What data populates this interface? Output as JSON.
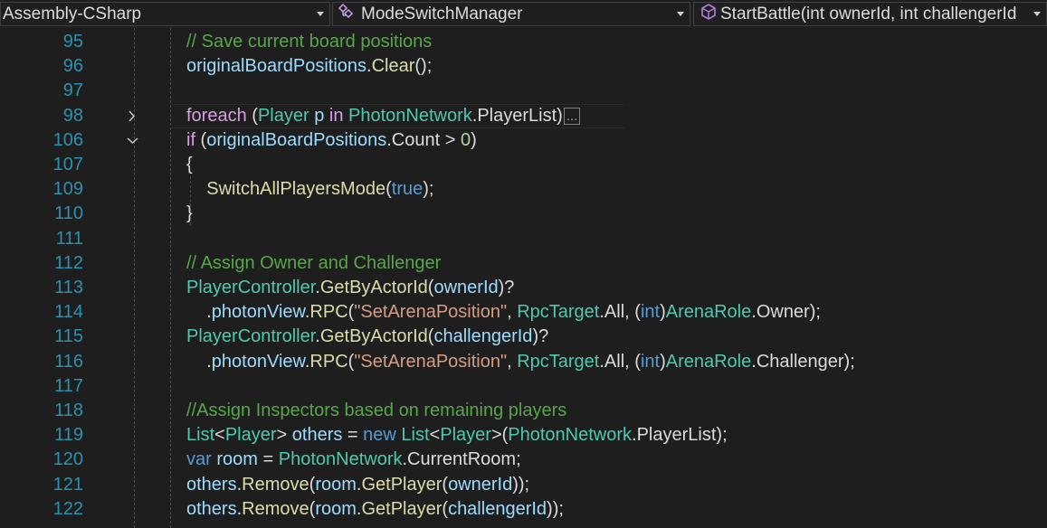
{
  "navbar": {
    "project": "Assembly-CSharp",
    "type": "ModeSwitchManager",
    "member": "StartBattle(int ownerId, int challengerId"
  },
  "colors": {
    "background": "#1e1e1e",
    "line_number": "#2b91af",
    "comment": "#57a64a",
    "control_keyword": "#d8a0df",
    "keyword": "#569cd6",
    "type": "#4ec9b0",
    "variable": "#9cdcfe",
    "method": "#dcdcaa",
    "string": "#d69d85",
    "number": "#b5cea8"
  },
  "lines": [
    {
      "num": "95",
      "fold": "",
      "tokens": [
        {
          "t": "// Save current board positions",
          "c": "c"
        }
      ]
    },
    {
      "num": "96",
      "fold": "",
      "tokens": [
        {
          "t": "originalBoardPositions",
          "c": "v"
        },
        {
          "t": ".",
          "c": "p"
        },
        {
          "t": "Clear",
          "c": "m"
        },
        {
          "t": "();",
          "c": "p"
        }
      ]
    },
    {
      "num": "97",
      "fold": "",
      "tokens": []
    },
    {
      "num": "98",
      "fold": "collapsed",
      "tokens": [
        {
          "t": "foreach",
          "c": "k"
        },
        {
          "t": " (",
          "c": "p"
        },
        {
          "t": "Player",
          "c": "t"
        },
        {
          "t": " ",
          "c": "p"
        },
        {
          "t": "p",
          "c": "v"
        },
        {
          "t": " ",
          "c": "p"
        },
        {
          "t": "in",
          "c": "k"
        },
        {
          "t": " ",
          "c": "p"
        },
        {
          "t": "PhotonNetwork",
          "c": "t"
        },
        {
          "t": ".",
          "c": "p"
        },
        {
          "t": "PlayerList",
          "c": "p"
        },
        {
          "t": ")",
          "c": "p"
        }
      ],
      "ellipsis": "..."
    },
    {
      "num": "106",
      "fold": "expanded",
      "tokens": [
        {
          "t": "if",
          "c": "k"
        },
        {
          "t": " (",
          "c": "p"
        },
        {
          "t": "originalBoardPositions",
          "c": "v"
        },
        {
          "t": ".",
          "c": "p"
        },
        {
          "t": "Count",
          "c": "p"
        },
        {
          "t": " > ",
          "c": "p"
        },
        {
          "t": "0",
          "c": "n"
        },
        {
          "t": ")",
          "c": "p"
        }
      ]
    },
    {
      "num": "107",
      "fold": "",
      "tokens": [
        {
          "t": "{",
          "c": "p"
        }
      ]
    },
    {
      "num": "109",
      "fold": "",
      "tokens": [
        {
          "t": "    ",
          "c": "p"
        },
        {
          "t": "SwitchAllPlayersMode",
          "c": "m"
        },
        {
          "t": "(",
          "c": "p"
        },
        {
          "t": "true",
          "c": "b"
        },
        {
          "t": ");",
          "c": "p"
        }
      ]
    },
    {
      "num": "110",
      "fold": "",
      "tokens": [
        {
          "t": "}",
          "c": "p"
        }
      ]
    },
    {
      "num": "111",
      "fold": "",
      "tokens": []
    },
    {
      "num": "112",
      "fold": "",
      "tokens": [
        {
          "t": "// Assign Owner and Challenger",
          "c": "c"
        }
      ]
    },
    {
      "num": "113",
      "fold": "",
      "tokens": [
        {
          "t": "PlayerController",
          "c": "t"
        },
        {
          "t": ".",
          "c": "p"
        },
        {
          "t": "GetByActorId",
          "c": "m"
        },
        {
          "t": "(",
          "c": "p"
        },
        {
          "t": "ownerId",
          "c": "v"
        },
        {
          "t": ")?",
          "c": "p"
        }
      ]
    },
    {
      "num": "114",
      "fold": "",
      "tokens": [
        {
          "t": "    .",
          "c": "p"
        },
        {
          "t": "photonView",
          "c": "v"
        },
        {
          "t": ".",
          "c": "p"
        },
        {
          "t": "RPC",
          "c": "m"
        },
        {
          "t": "(",
          "c": "p"
        },
        {
          "t": "\"SetArenaPosition\"",
          "c": "s"
        },
        {
          "t": ", ",
          "c": "p"
        },
        {
          "t": "RpcTarget",
          "c": "t"
        },
        {
          "t": ".",
          "c": "p"
        },
        {
          "t": "All",
          "c": "p"
        },
        {
          "t": ", (",
          "c": "p"
        },
        {
          "t": "int",
          "c": "b"
        },
        {
          "t": ")",
          "c": "p"
        },
        {
          "t": "ArenaRole",
          "c": "t"
        },
        {
          "t": ".",
          "c": "p"
        },
        {
          "t": "Owner",
          "c": "p"
        },
        {
          "t": ");",
          "c": "p"
        }
      ]
    },
    {
      "num": "115",
      "fold": "",
      "tokens": [
        {
          "t": "PlayerController",
          "c": "t"
        },
        {
          "t": ".",
          "c": "p"
        },
        {
          "t": "GetByActorId",
          "c": "m"
        },
        {
          "t": "(",
          "c": "p"
        },
        {
          "t": "challengerId",
          "c": "v"
        },
        {
          "t": ")?",
          "c": "p"
        }
      ]
    },
    {
      "num": "116",
      "fold": "",
      "tokens": [
        {
          "t": "    .",
          "c": "p"
        },
        {
          "t": "photonView",
          "c": "v"
        },
        {
          "t": ".",
          "c": "p"
        },
        {
          "t": "RPC",
          "c": "m"
        },
        {
          "t": "(",
          "c": "p"
        },
        {
          "t": "\"SetArenaPosition\"",
          "c": "s"
        },
        {
          "t": ", ",
          "c": "p"
        },
        {
          "t": "RpcTarget",
          "c": "t"
        },
        {
          "t": ".",
          "c": "p"
        },
        {
          "t": "All",
          "c": "p"
        },
        {
          "t": ", (",
          "c": "p"
        },
        {
          "t": "int",
          "c": "b"
        },
        {
          "t": ")",
          "c": "p"
        },
        {
          "t": "ArenaRole",
          "c": "t"
        },
        {
          "t": ".",
          "c": "p"
        },
        {
          "t": "Challenger",
          "c": "p"
        },
        {
          "t": ");",
          "c": "p"
        }
      ]
    },
    {
      "num": "117",
      "fold": "",
      "tokens": []
    },
    {
      "num": "118",
      "fold": "",
      "tokens": [
        {
          "t": "//Assign Inspectors based on remaining players",
          "c": "c"
        }
      ]
    },
    {
      "num": "119",
      "fold": "",
      "tokens": [
        {
          "t": "List",
          "c": "t"
        },
        {
          "t": "<",
          "c": "p"
        },
        {
          "t": "Player",
          "c": "t"
        },
        {
          "t": "> ",
          "c": "p"
        },
        {
          "t": "others",
          "c": "v"
        },
        {
          "t": " = ",
          "c": "p"
        },
        {
          "t": "new",
          "c": "b"
        },
        {
          "t": " ",
          "c": "p"
        },
        {
          "t": "List",
          "c": "t"
        },
        {
          "t": "<",
          "c": "p"
        },
        {
          "t": "Player",
          "c": "t"
        },
        {
          "t": ">(",
          "c": "p"
        },
        {
          "t": "PhotonNetwork",
          "c": "t"
        },
        {
          "t": ".",
          "c": "p"
        },
        {
          "t": "PlayerList",
          "c": "p"
        },
        {
          "t": ");",
          "c": "p"
        }
      ]
    },
    {
      "num": "120",
      "fold": "",
      "tokens": [
        {
          "t": "var",
          "c": "b"
        },
        {
          "t": " ",
          "c": "p"
        },
        {
          "t": "room",
          "c": "v"
        },
        {
          "t": " = ",
          "c": "p"
        },
        {
          "t": "PhotonNetwork",
          "c": "t"
        },
        {
          "t": ".",
          "c": "p"
        },
        {
          "t": "CurrentRoom",
          "c": "p"
        },
        {
          "t": ";",
          "c": "p"
        }
      ]
    },
    {
      "num": "121",
      "fold": "",
      "tokens": [
        {
          "t": "others",
          "c": "v"
        },
        {
          "t": ".",
          "c": "p"
        },
        {
          "t": "Remove",
          "c": "m"
        },
        {
          "t": "(",
          "c": "p"
        },
        {
          "t": "room",
          "c": "v"
        },
        {
          "t": ".",
          "c": "p"
        },
        {
          "t": "GetPlayer",
          "c": "m"
        },
        {
          "t": "(",
          "c": "p"
        },
        {
          "t": "ownerId",
          "c": "v"
        },
        {
          "t": "));",
          "c": "p"
        }
      ]
    },
    {
      "num": "122",
      "fold": "",
      "tokens": [
        {
          "t": "others",
          "c": "v"
        },
        {
          "t": ".",
          "c": "p"
        },
        {
          "t": "Remove",
          "c": "m"
        },
        {
          "t": "(",
          "c": "p"
        },
        {
          "t": "room",
          "c": "v"
        },
        {
          "t": ".",
          "c": "p"
        },
        {
          "t": "GetPlayer",
          "c": "m"
        },
        {
          "t": "(",
          "c": "p"
        },
        {
          "t": "challengerId",
          "c": "v"
        },
        {
          "t": "));",
          "c": "p"
        }
      ]
    }
  ]
}
